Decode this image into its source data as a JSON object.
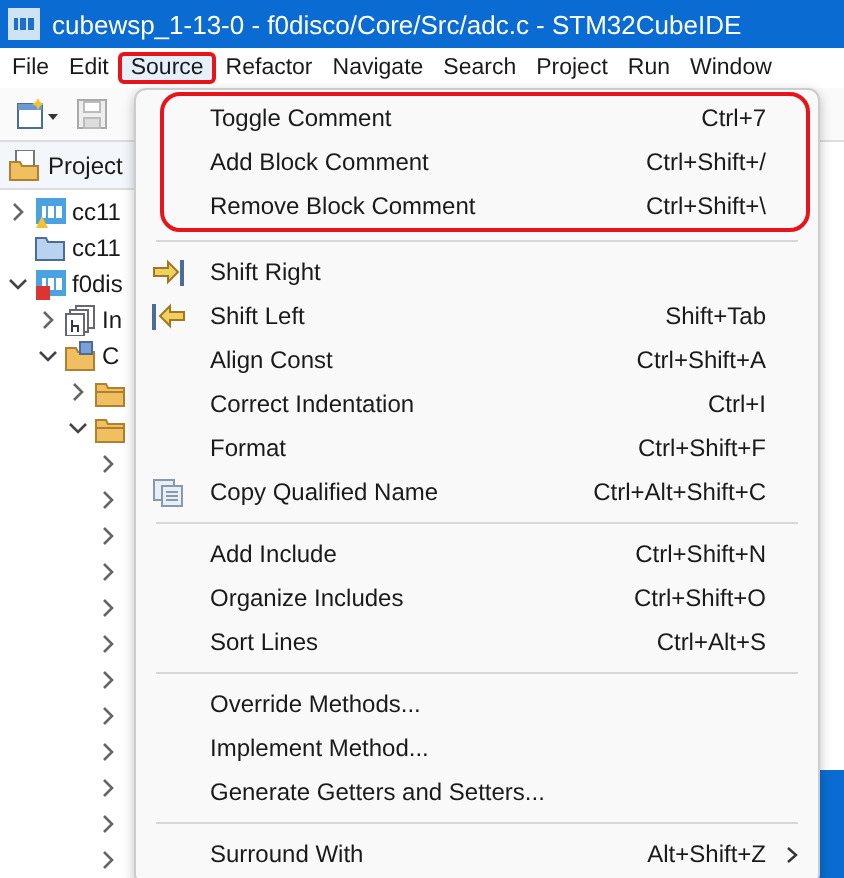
{
  "window": {
    "title": "cubewsp_1-13-0 - f0disco/Core/Src/adc.c - STM32CubeIDE"
  },
  "menu_bar": [
    {
      "label": "File",
      "selected": false,
      "annotated": false
    },
    {
      "label": "Edit",
      "selected": false,
      "annotated": false
    },
    {
      "label": "Source",
      "selected": true,
      "annotated": true
    },
    {
      "label": "Refactor",
      "selected": false,
      "annotated": false
    },
    {
      "label": "Navigate",
      "selected": false,
      "annotated": false
    },
    {
      "label": "Search",
      "selected": false,
      "annotated": false
    },
    {
      "label": "Project",
      "selected": false,
      "annotated": false
    },
    {
      "label": "Run",
      "selected": false,
      "annotated": false
    },
    {
      "label": "Window",
      "selected": false,
      "annotated": false
    }
  ],
  "project_explorer": {
    "title": "Project",
    "tree": [
      {
        "label": "cc11",
        "kind": "warning_project",
        "expanded": false
      },
      {
        "label": "cc11",
        "kind": "closed_project"
      },
      {
        "label": "f0dis",
        "kind": "error_project",
        "expanded": true,
        "children": [
          {
            "label": "In",
            "kind": "includes",
            "expanded": false
          },
          {
            "label": "C",
            "kind": "source_folder",
            "expanded": true,
            "children": [
              {
                "kind": "folder",
                "expanded": false
              },
              {
                "kind": "folder",
                "expanded": true,
                "children": [
                  {
                    "expanded": false
                  },
                  {
                    "expanded": false
                  },
                  {
                    "expanded": false
                  },
                  {
                    "expanded": false
                  },
                  {
                    "expanded": false
                  },
                  {
                    "expanded": false
                  },
                  {
                    "expanded": false
                  },
                  {
                    "expanded": false
                  },
                  {
                    "expanded": false
                  },
                  {
                    "expanded": false
                  },
                  {
                    "expanded": false
                  },
                  {
                    "expanded": false
                  }
                ]
              }
            ]
          }
        ]
      }
    ]
  },
  "source_menu": {
    "groups": [
      {
        "annotated": true,
        "items": [
          {
            "label": "Toggle Comment",
            "shortcut": "Ctrl+7"
          },
          {
            "label": "Add Block Comment",
            "shortcut": "Ctrl+Shift+/"
          },
          {
            "label": "Remove Block Comment",
            "shortcut": "Ctrl+Shift+\\"
          }
        ]
      },
      {
        "items": [
          {
            "label": "Shift Right",
            "kind": "shift_right"
          },
          {
            "label": "Shift Left",
            "shortcut": "Shift+Tab",
            "kind": "shift_left"
          },
          {
            "label": "Align Const",
            "shortcut": "Ctrl+Shift+A"
          },
          {
            "label": "Correct Indentation",
            "shortcut": "Ctrl+I"
          },
          {
            "label": "Format",
            "shortcut": "Ctrl+Shift+F"
          },
          {
            "label": "Copy Qualified Name",
            "shortcut": "Ctrl+Alt+Shift+C",
            "kind": "copy"
          }
        ]
      },
      {
        "items": [
          {
            "label": "Add Include",
            "shortcut": "Ctrl+Shift+N"
          },
          {
            "label": "Organize Includes",
            "shortcut": "Ctrl+Shift+O"
          },
          {
            "label": "Sort Lines",
            "shortcut": "Ctrl+Alt+S"
          }
        ]
      },
      {
        "items": [
          {
            "label": "Override Methods..."
          },
          {
            "label": "Implement Method..."
          },
          {
            "label": "Generate Getters and Setters..."
          }
        ]
      },
      {
        "items": [
          {
            "label": "Surround With",
            "shortcut": "Alt+Shift+Z",
            "submenu": true
          }
        ]
      }
    ]
  }
}
